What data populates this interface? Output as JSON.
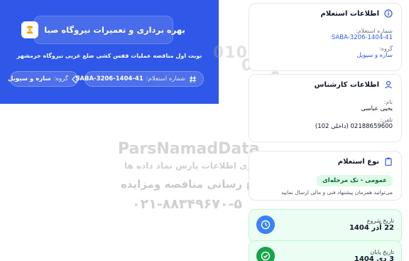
{
  "hero": {
    "title": "بهره برداری و تعمیرات نیروگاه صبا",
    "subtitle": "نوبت اول مناقصه عملیات قفس کشی ضلع غربی نیروگاه خرمشهر",
    "code_label": "شماره استعلام:",
    "code_value": "SABA-3206-1404-41",
    "group_label": "گروه:",
    "group_value": "سازه و سیویل"
  },
  "inquiry_info": {
    "title": "اطلاعات استعلام",
    "number_label": "شماره استعلام:",
    "number_value": "SABA-3206-1404-41",
    "group_label": "گروه:",
    "group_value": "سازه و سیویل"
  },
  "expert_info": {
    "title": "اطلاعات کارشناس",
    "name_label": "نام:",
    "name_value": "یحیی عباسی",
    "phone_label": "تلفن:",
    "phone_value": "02188659600 (داخلی 102)"
  },
  "inquiry_type": {
    "title": "نوع استعلام",
    "badge": "عمومی - تک مرحله‌ای",
    "note": "می‌توانید همزمان پیشنهاد فنی و مالی ارسال نمایید"
  },
  "dates": {
    "start_label": "تاریخ شروع",
    "start_value": "22 آذر 1404",
    "end_label": "تاریخ پایان",
    "end_value": "3 دی 1404"
  },
  "watermark": {
    "digits_1": "010101",
    "digits_2": "0001",
    "digits_3": "0",
    "digits_4": "0",
    "brand": "ParsNamadData",
    "line1": "مرکز فراوری اطلاعات پارس نماد داده ها",
    "line2": "پایگاه اطلاع رسانی مناقصه ومزایده",
    "phone": "۰۲۱-۸۸۳۴۹۶۷۰-۵"
  },
  "colors": {
    "primary": "#2f58e8",
    "success_bg": "#ecfdf3",
    "badge_bg": "#dcfce7"
  }
}
